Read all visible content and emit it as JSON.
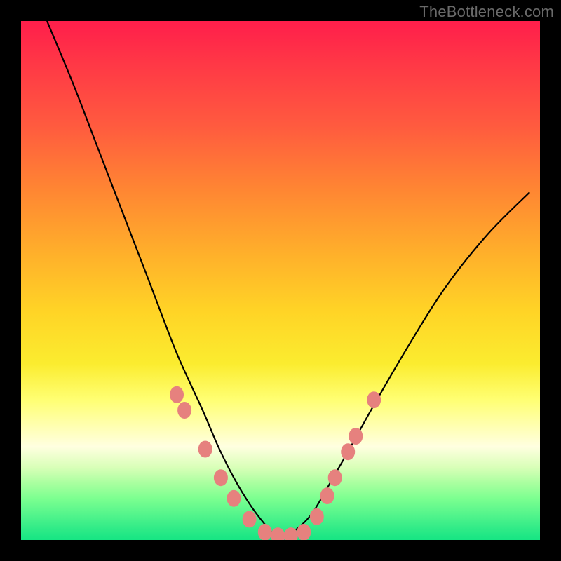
{
  "watermark": "TheBottleneck.com",
  "chart_data": {
    "type": "line",
    "title": "",
    "xlabel": "",
    "ylabel": "",
    "xlim": [
      0,
      100
    ],
    "ylim": [
      0,
      100
    ],
    "note": "Bottleneck-style V-curve with rainbow gradient background. Values are approximate, read from curve position relative to plot area (0 = bottom, 100 = top).",
    "series": [
      {
        "name": "bottleneck-curve",
        "x": [
          5,
          10,
          15,
          20,
          25,
          30,
          35,
          38,
          41,
          44,
          47,
          49,
          51,
          53,
          56,
          59,
          63,
          68,
          75,
          82,
          90,
          98
        ],
        "values": [
          100,
          88,
          75,
          62,
          49,
          36,
          25,
          18,
          12,
          7,
          3,
          1,
          1,
          2,
          5,
          10,
          17,
          26,
          38,
          49,
          59,
          67
        ]
      }
    ],
    "markers": [
      {
        "x": 30.0,
        "y": 28.0
      },
      {
        "x": 31.5,
        "y": 25.0
      },
      {
        "x": 35.5,
        "y": 17.5
      },
      {
        "x": 38.5,
        "y": 12.0
      },
      {
        "x": 41.0,
        "y": 8.0
      },
      {
        "x": 44.0,
        "y": 4.0
      },
      {
        "x": 47.0,
        "y": 1.5
      },
      {
        "x": 49.5,
        "y": 0.8
      },
      {
        "x": 52.0,
        "y": 0.8
      },
      {
        "x": 54.5,
        "y": 1.5
      },
      {
        "x": 57.0,
        "y": 4.5
      },
      {
        "x": 59.0,
        "y": 8.5
      },
      {
        "x": 60.5,
        "y": 12.0
      },
      {
        "x": 63.0,
        "y": 17.0
      },
      {
        "x": 64.5,
        "y": 20.0
      },
      {
        "x": 68.0,
        "y": 27.0
      }
    ],
    "marker_color": "#e6817e",
    "curve_color": "#000000"
  }
}
